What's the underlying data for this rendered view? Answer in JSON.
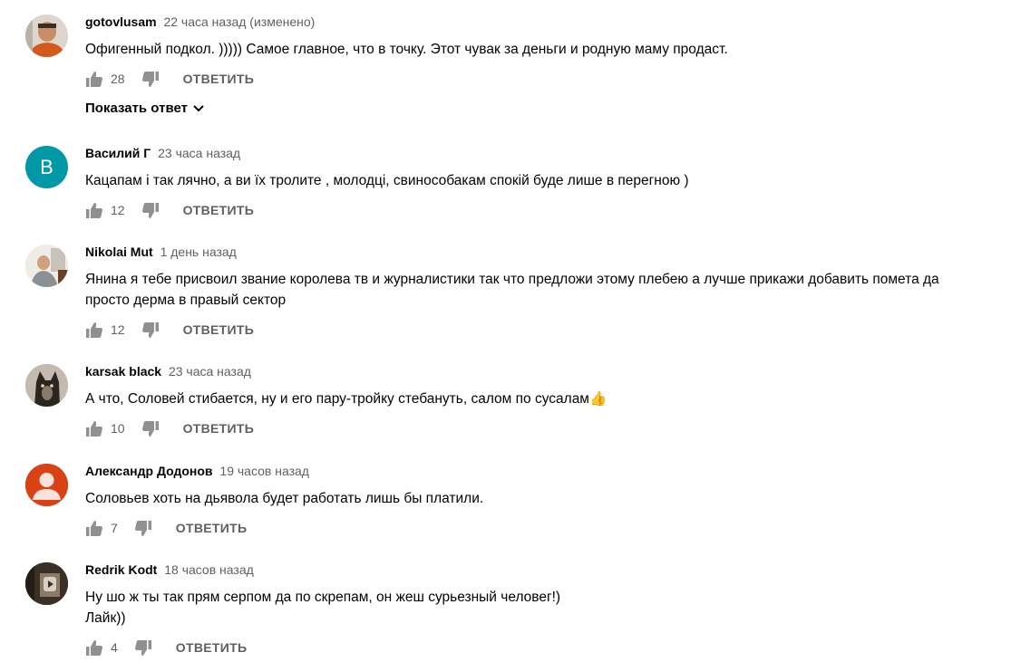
{
  "comments": [
    {
      "author": "gotovlusam",
      "time": "22 часа назад (изменено)",
      "text": "Офигенный подкол. )))))  Самое главное, что в точку. Этот чувак за деньги и родную маму продаст.",
      "likes": "28",
      "reply_label": "ОТВЕТИТЬ",
      "show_replies_label": "Показать ответ",
      "avatar_icon": "photo-avatar-man-orange"
    },
    {
      "author": "Василий Г",
      "time": "23 часа назад",
      "text": "Кацапам і так лячно, а ви їх тролите , молодці, свинособакам спокій буде лише в перегною )",
      "likes": "12",
      "reply_label": "ОТВЕТИТЬ",
      "avatar_letter": "В",
      "avatar_color": "#0097a7"
    },
    {
      "author": "Nikolai Mut",
      "time": "1 день назад",
      "text": "Янина я тебе присвоил звание королева тв и журналистики так что предложи этому плебею а лучше прикажи добавить помета да\nпросто дерма в правый сектор",
      "likes": "12",
      "reply_label": "ОТВЕТИТЬ",
      "avatar_icon": "photo-avatar-man-room"
    },
    {
      "author": "karsak black",
      "time": "23 часа назад",
      "text": "А что, Соловей стибается, ну и его пару-тройку стебануть, салом по сусалам👍",
      "likes": "10",
      "reply_label": "ОТВЕТИТЬ",
      "avatar_icon": "photo-avatar-dog"
    },
    {
      "author": "Александр Додонов",
      "time": "19 часов назад",
      "text": "Соловьев хоть на дьявола будет работать лишь бы платили.",
      "likes": "7",
      "reply_label": "ОТВЕТИТЬ",
      "avatar_icon": "default-person-avatar",
      "avatar_color": "#d84315"
    },
    {
      "author": "Redrik Kodt",
      "time": "18 часов назад",
      "text": "Ну шо ж ты так прям серпом да по скрепам, он жеш сурьезный человег!)\nЛайк))",
      "likes": "4",
      "reply_label": "ОТВЕТИТЬ",
      "avatar_icon": "photo-avatar-play"
    }
  ],
  "colors": {
    "meta_gray": "#606060",
    "text_dark": "#030303",
    "icon_gray": "#909090"
  }
}
